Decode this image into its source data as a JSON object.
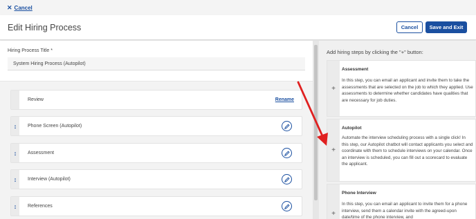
{
  "topbar": {
    "cancel_icon": "close-icon",
    "cancel_label": "Cancel"
  },
  "header": {
    "title": "Edit Hiring Process",
    "cancel_label": "Cancel",
    "save_label": "Save and Exit"
  },
  "form": {
    "title_label": "Hiring Process Title *",
    "title_value": "System Hiring Process  (Autopilot)"
  },
  "steps": [
    {
      "name": "Review",
      "action": "Rename"
    },
    {
      "name": "Phone Screen (Autopilot)",
      "handle_icon": "drag-handle-icon",
      "edit_icon": "pencil-icon"
    },
    {
      "name": "Assessment",
      "handle_icon": "drag-handle-icon",
      "edit_icon": "pencil-icon"
    },
    {
      "name": "Interview (Autopilot)",
      "handle_icon": "drag-handle-icon",
      "edit_icon": "pencil-icon"
    },
    {
      "name": "References",
      "handle_icon": "drag-handle-icon",
      "edit_icon": "pencil-icon"
    }
  ],
  "right_panel": {
    "title": "Add hiring steps by clicking the \"+\" button:",
    "cards": [
      {
        "title": "Assessment",
        "desc": "In this step, you can email an applicant and invite them to take the assessments that are selected on the job to which they applied. Use assessments to determine whether candidates have qualities that are necessary for job duties."
      },
      {
        "title": "Autopilot",
        "desc": "Automate the interview scheduling process with a single click! In this step, our Autopilot chatbot will contact applicants you select and coordinate with them to schedule interviews on your calendar. Once an interview is scheduled, you can fill out a scorecard to evaluate the applicant."
      },
      {
        "title": "Phone Interview",
        "desc": "In this step, you can email an applicant to invite them for a phone interview, send them a calendar invite with the agreed-upon date/time of the phone interview, and"
      }
    ]
  },
  "colors": {
    "accent": "#1a4fa0",
    "arrow": "#e02020"
  }
}
